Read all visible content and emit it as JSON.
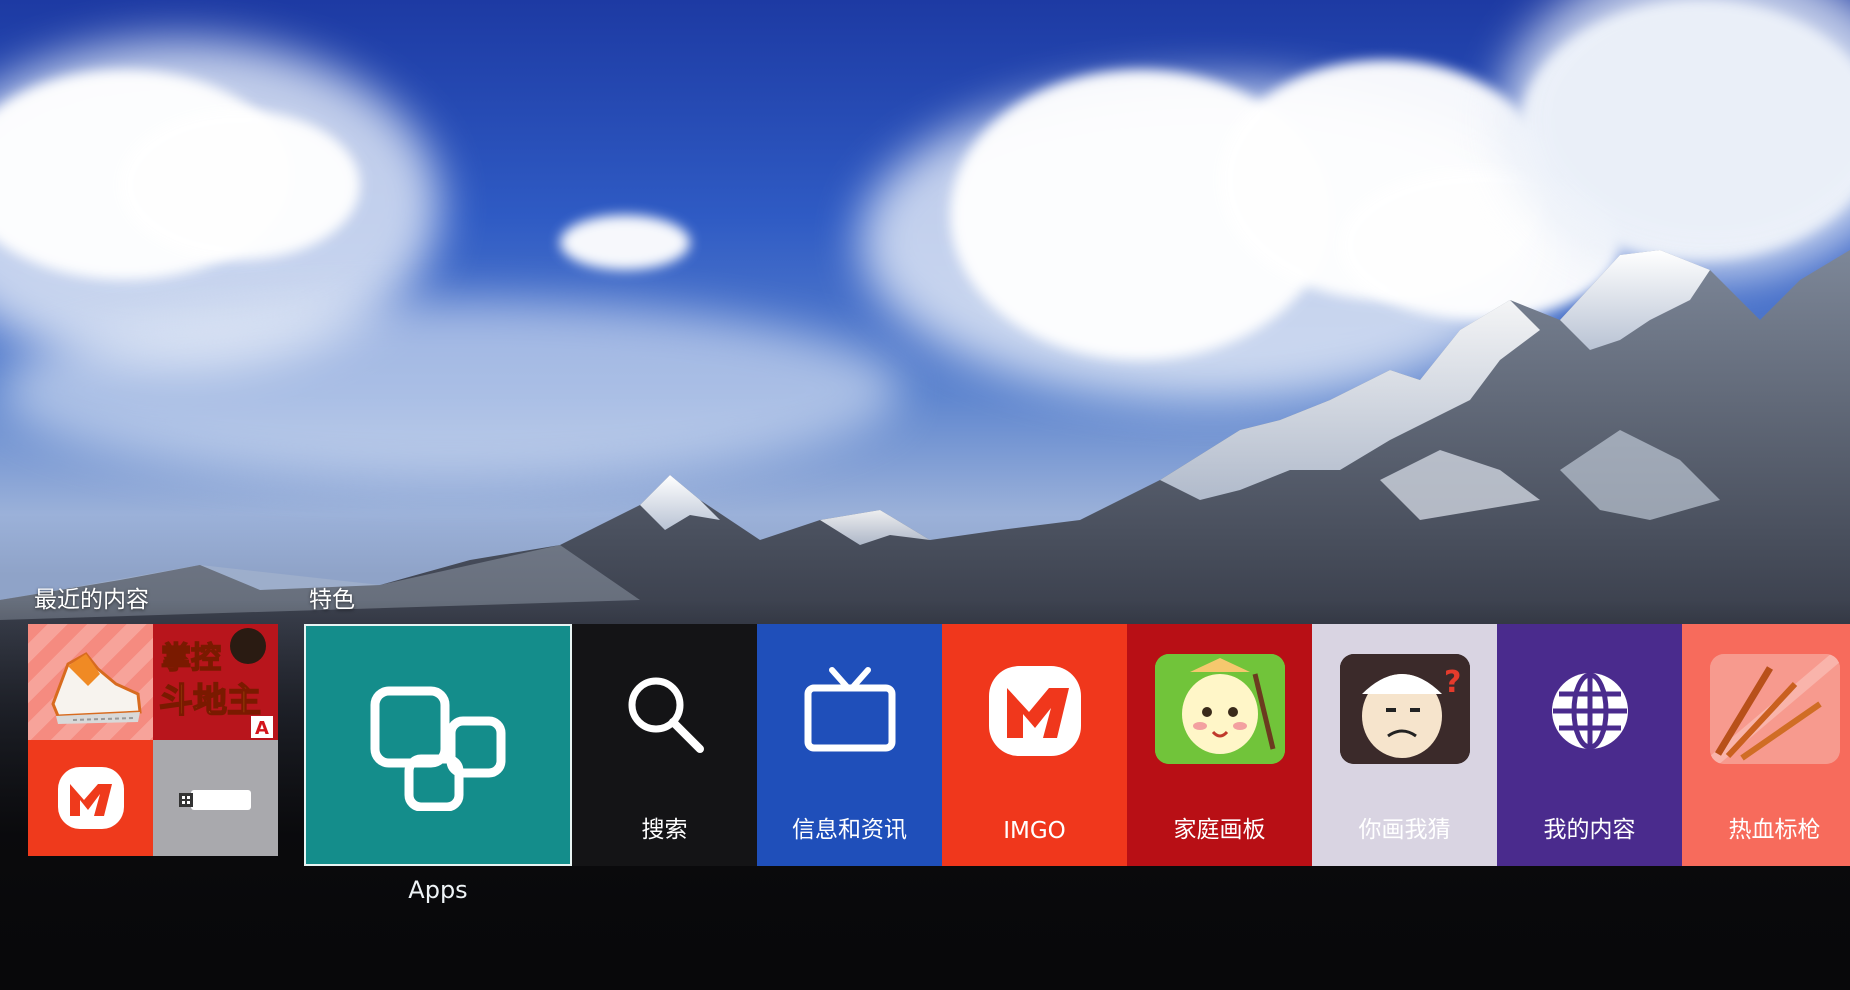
{
  "sections": {
    "recent_title": "最近的内容",
    "featured_title": "特色"
  },
  "recent": {
    "items": [
      {
        "name": "running-shoe-app",
        "icon": "sneaker-icon",
        "color": "#f58b80"
      },
      {
        "name": "doudizhu-game",
        "icon": "doudizhu-logo",
        "text": "掌控斗地主",
        "color": "#b8151c"
      },
      {
        "name": "imgo-recent",
        "icon": "mango-tv-logo",
        "color": "#ef3a1c"
      },
      {
        "name": "usb-device",
        "icon": "usb-drive-icon",
        "color": "#a9a9ad"
      }
    ]
  },
  "featured": {
    "apps": {
      "label": "Apps",
      "icon": "apps-icon",
      "color": "#148d8b"
    },
    "tiles": [
      {
        "label": "搜索",
        "icon": "search-icon",
        "color": "#141416"
      },
      {
        "label": "信息和资讯",
        "icon": "tv-icon",
        "color": "#1f4fba"
      },
      {
        "label": "IMGO",
        "icon": "mango-tv-logo",
        "color": "#f0371c"
      },
      {
        "label": "家庭画板",
        "icon": "paint-app-icon",
        "color": "#b80f15"
      },
      {
        "label": "你画我猜",
        "icon": "guess-drawing-app-icon",
        "color": "#d9d4e2"
      },
      {
        "label": "我的内容",
        "icon": "globe-icon",
        "color": "#4a2b8d"
      },
      {
        "label": "热血标枪",
        "icon": "javelin-game-icon",
        "color": "#f76b5c"
      }
    ]
  }
}
